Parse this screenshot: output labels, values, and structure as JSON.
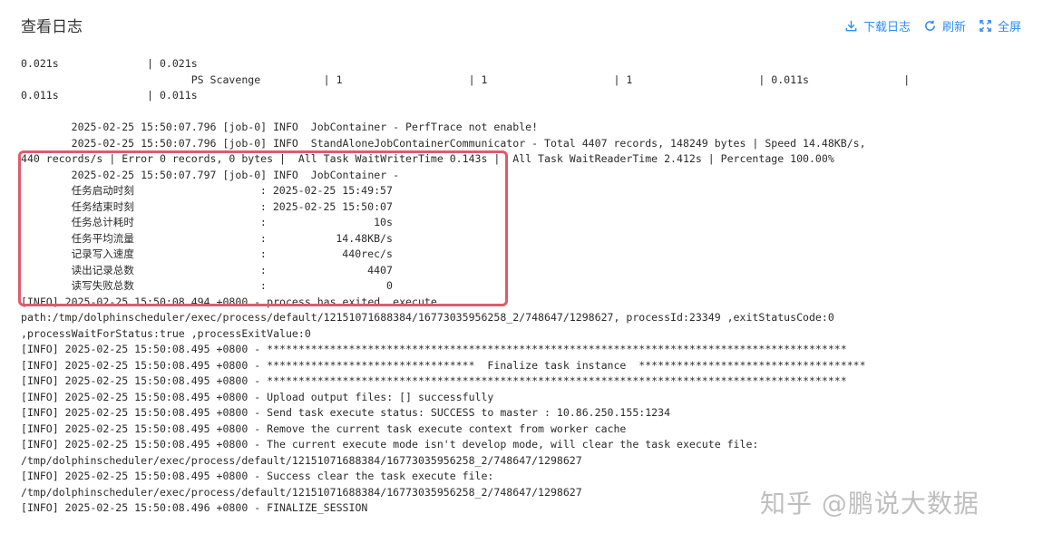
{
  "header": {
    "title": "查看日志",
    "download_label": "下载日志",
    "refresh_label": "刷新",
    "fullscreen_label": "全屏"
  },
  "log_lines": [
    "0.021s              | 0.021s",
    "                           PS Scavenge          | 1                    | 1                    | 1                    | 0.011s               |",
    "0.011s              | 0.011s",
    "",
    "        2025-02-25 15:50:07.796 [job-0] INFO  JobContainer - PerfTrace not enable!",
    "        2025-02-25 15:50:07.796 [job-0] INFO  StandAloneJobContainerCommunicator - Total 4407 records, 148249 bytes | Speed 14.48KB/s,",
    "440 records/s | Error 0 records, 0 bytes |  All Task WaitWriterTime 0.143s |  All Task WaitReaderTime 2.412s | Percentage 100.00%",
    "        2025-02-25 15:50:07.797 [job-0] INFO  JobContainer -",
    "        任务启动时刻                    : 2025-02-25 15:49:57",
    "        任务结束时刻                    : 2025-02-25 15:50:07",
    "        任务总计耗时                    :                 10s",
    "        任务平均流量                    :           14.48KB/s",
    "        记录写入速度                    :            440rec/s",
    "        读出记录总数                    :                4407",
    "        读写失败总数                    :                   0",
    "[INFO] 2025-02-25 15:50:08.494 +0800 - process has exited. execute",
    "path:/tmp/dolphinscheduler/exec/process/default/12151071688384/16773035956258_2/748647/1298627, processId:23349 ,exitStatusCode:0",
    ",processWaitForStatus:true ,processExitValue:0",
    "[INFO] 2025-02-25 15:50:08.495 +0800 - ********************************************************************************************",
    "[INFO] 2025-02-25 15:50:08.495 +0800 - *********************************  Finalize task instance  ************************************",
    "[INFO] 2025-02-25 15:50:08.495 +0800 - ********************************************************************************************",
    "[INFO] 2025-02-25 15:50:08.495 +0800 - Upload output files: [] successfully",
    "[INFO] 2025-02-25 15:50:08.495 +0800 - Send task execute status: SUCCESS to master : 10.86.250.155:1234",
    "[INFO] 2025-02-25 15:50:08.495 +0800 - Remove the current task execute context from worker cache",
    "[INFO] 2025-02-25 15:50:08.495 +0800 - The current execute mode isn't develop mode, will clear the task execute file:",
    "/tmp/dolphinscheduler/exec/process/default/12151071688384/16773035956258_2/748647/1298627",
    "[INFO] 2025-02-25 15:50:08.495 +0800 - Success clear the task execute file:",
    "/tmp/dolphinscheduler/exec/process/default/12151071688384/16773035956258_2/748647/1298627",
    "[INFO] 2025-02-25 15:50:08.496 +0800 - FINALIZE_SESSION"
  ],
  "watermark": {
    "text": "知乎 @鹏说大数据"
  },
  "colors": {
    "accent": "#2d8cf0",
    "highlight_border": "#e05a6e"
  },
  "icons": {
    "download": "download-icon",
    "refresh": "refresh-icon",
    "fullscreen": "fullscreen-icon"
  }
}
